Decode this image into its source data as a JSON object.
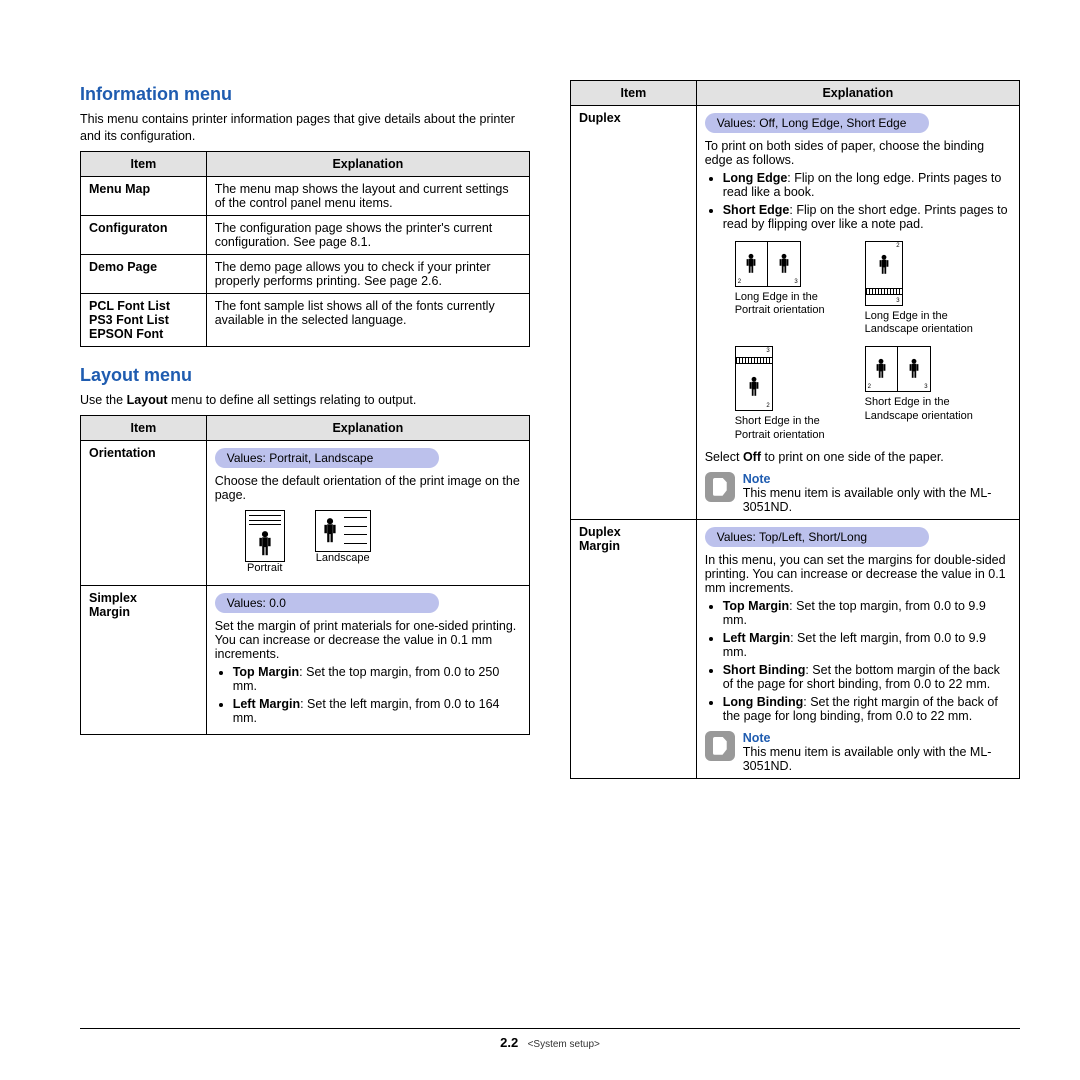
{
  "left": {
    "info_heading": "Information menu",
    "info_intro": "This menu contains printer information pages that give details about the printer and its configuration.",
    "info_th_item": "Item",
    "info_th_exp": "Explanation",
    "info_rows": {
      "r0_item": "Menu Map",
      "r0_exp": "The menu map shows the layout and current settings of the control panel menu items.",
      "r1_item": "Configuraton",
      "r1_exp": "The configuration page shows the printer's current configuration. See page 8.1.",
      "r2_item": "Demo Page",
      "r2_exp": "The demo page allows you to check if your printer properly performs printing. See page 2.6.",
      "r3_item_a": "PCL Font List",
      "r3_item_b": "PS3 Font List",
      "r3_item_c": "EPSON Font",
      "r3_exp": "The font sample list shows all of the fonts currently available in the selected language."
    },
    "layout_heading": "Layout menu",
    "layout_intro_a": "Use the ",
    "layout_intro_b": "Layout",
    "layout_intro_c": " menu to define all settings relating to output.",
    "layout_th_item": "Item",
    "layout_th_exp": "Explanation",
    "orientation": {
      "item": "Orientation",
      "values": "Values: Portrait, Landscape",
      "desc": "Choose the default orientation of the print image on the page.",
      "cap_p": "Portrait",
      "cap_l": "Landscape"
    },
    "simplex": {
      "item_a": "Simplex",
      "item_b": "Margin",
      "values": "Values: 0.0",
      "desc": "Set the margin of print materials for one-sided printing. You can increase or decrease the value in 0.1 mm increments.",
      "li1_b": "Top Margin",
      "li1": ": Set the top margin, from 0.0 to 250 mm.",
      "li2_b": "Left Margin",
      "li2": ": Set the left margin, from 0.0 to 164 mm."
    }
  },
  "right": {
    "th_item": "Item",
    "th_exp": "Explanation",
    "duplex": {
      "item": "Duplex",
      "values": "Values: Off, Long Edge, Short Edge",
      "desc": "To print on both sides of paper, choose the binding edge as follows.",
      "li1_b": "Long Edge",
      "li1": ": Flip on the long edge. Prints pages to read like a book.",
      "li2_b": "Short Edge",
      "li2": ": Flip on the short edge. Prints pages to read by flipping over like a note pad.",
      "cap1a": "Long Edge in the",
      "cap1b": "Portrait orientation",
      "cap2a": "Long Edge in the",
      "cap2b": "Landscape orientation",
      "cap3a": "Short Edge in the",
      "cap3b": "Portrait orientation",
      "cap4a": "Short Edge in the",
      "cap4b": "Landscape orientation",
      "select_a": "Select ",
      "select_b": "Off",
      "select_c": " to print on one side of the paper.",
      "note_title": "Note",
      "note_body": "This menu item is available only with the ML-3051ND."
    },
    "dmargin": {
      "item_a": "Duplex",
      "item_b": "Margin",
      "values": "Values: Top/Left, Short/Long",
      "desc": "In this menu, you can set the margins for double-sided printing. You can increase or decrease the value in 0.1 mm increments.",
      "li1_b": "Top Margin",
      "li1": ": Set the top margin, from 0.0 to 9.9 mm.",
      "li2_b": "Left Margin",
      "li2": ": Set the left margin, from 0.0 to 9.9 mm.",
      "li3_b": "Short Binding",
      "li3": ": Set the bottom margin of the back of the page for short binding, from 0.0 to 22 mm.",
      "li4_b": "Long Binding",
      "li4": ": Set the right margin of the back of the page for long binding, from 0.0 to 22 mm.",
      "note_title": "Note",
      "note_body": "This menu item is available only with the ML-3051ND."
    }
  },
  "footer": {
    "page": "2.2",
    "section": "<System setup>"
  }
}
